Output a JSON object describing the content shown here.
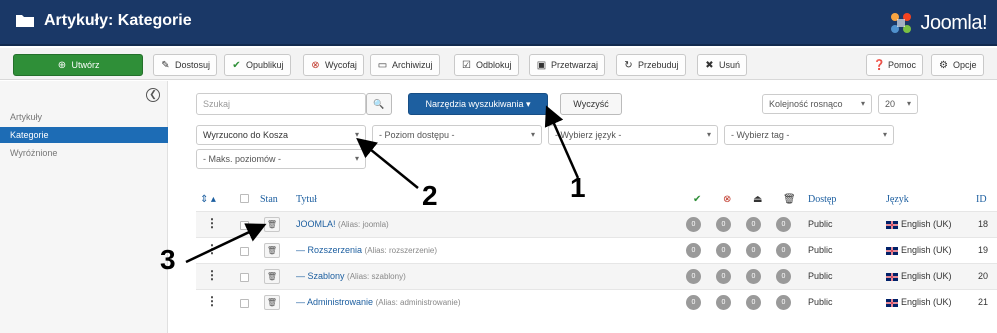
{
  "header": {
    "title": "Artykuły: Kategorie",
    "logo_text": "Joomla!"
  },
  "toolbar": {
    "new": "Utwórz",
    "edit": "Dostosuj",
    "publish": "Opublikuj",
    "unpublish": "Wycofaj",
    "archive": "Archiwizuj",
    "checkin": "Odblokuj",
    "batch": "Przetwarzaj",
    "rebuild": "Przebuduj",
    "delete": "Usuń",
    "help": "Pomoc",
    "options": "Opcje"
  },
  "sidebar": {
    "items": [
      {
        "label": "Artykuły"
      },
      {
        "label": "Kategorie"
      },
      {
        "label": "Wyróżnione"
      }
    ]
  },
  "filters": {
    "search_placeholder": "Szukaj",
    "search_tools": "Narzędzia wyszukiwania ▾",
    "clear": "Wyczyść",
    "ordering": "Kolejność rosnąco",
    "limit": "20",
    "status": "Wyrzucono do Kosza",
    "access": "- Poziom dostępu -",
    "language": "- Wybierz język -",
    "tag": "- Wybierz tag -",
    "max_levels": "- Maks. poziomów -"
  },
  "table": {
    "headers": {
      "sort": "⇕ ▴",
      "status": "Stan",
      "title": "Tytuł",
      "access": "Dostęp",
      "language": "Język",
      "id": "ID"
    },
    "rows": [
      {
        "title": "JOOMLA!",
        "alias": "(Alias: joomla)",
        "c1": "0",
        "c2": "0",
        "c3": "0",
        "c4": "0",
        "access": "Public",
        "language": "English (UK)",
        "id": "18"
      },
      {
        "title": "— Rozszerzenia",
        "alias": "(Alias: rozszerzenie)",
        "c1": "0",
        "c2": "0",
        "c3": "0",
        "c4": "0",
        "access": "Public",
        "language": "English (UK)",
        "id": "19"
      },
      {
        "title": "— Szablony",
        "alias": "(Alias: szablony)",
        "c1": "0",
        "c2": "0",
        "c3": "0",
        "c4": "0",
        "access": "Public",
        "language": "English (UK)",
        "id": "20"
      },
      {
        "title": "— Administrowanie",
        "alias": "(Alias: administrowanie)",
        "c1": "0",
        "c2": "0",
        "c3": "0",
        "c4": "0",
        "access": "Public",
        "language": "English (UK)",
        "id": "21"
      }
    ]
  },
  "callouts": {
    "one": "1",
    "two": "2",
    "three": "3"
  }
}
